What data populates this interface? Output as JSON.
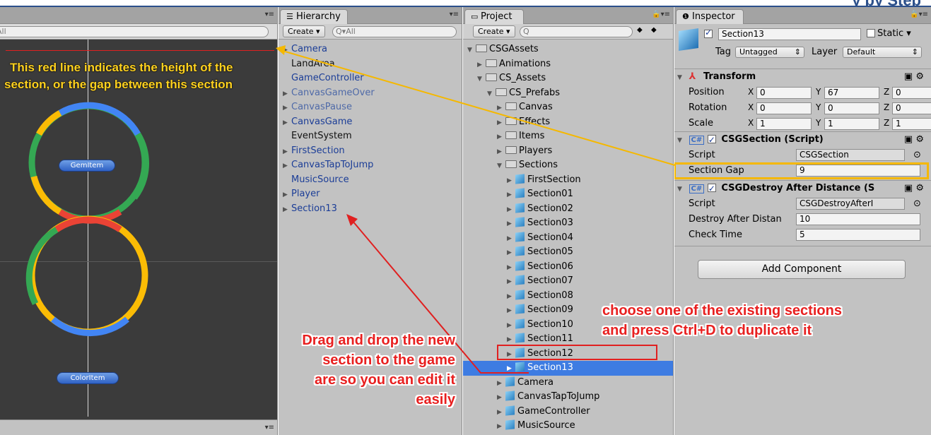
{
  "top": {
    "cutoff_text": "y by Step"
  },
  "scene": {
    "search_placeholder": "All",
    "items": [
      {
        "label": "GemItem"
      },
      {
        "label": "ColorItem"
      }
    ]
  },
  "hierarchy": {
    "tab": "Hierarchy",
    "create_label": "Create",
    "search_placeholder": "All",
    "items": [
      {
        "label": "Camera",
        "expandable": true
      },
      {
        "label": "LandArea",
        "expandable": false
      },
      {
        "label": "GameController",
        "expandable": false
      },
      {
        "label": "CanvasGameOver",
        "expandable": true
      },
      {
        "label": "CanvasPause",
        "expandable": true
      },
      {
        "label": "CanvasGame",
        "expandable": true
      },
      {
        "label": "EventSystem",
        "expandable": false
      },
      {
        "label": "FirstSection",
        "expandable": true
      },
      {
        "label": "CanvasTapToJump",
        "expandable": true
      },
      {
        "label": "MusicSource",
        "expandable": false
      },
      {
        "label": "Player",
        "expandable": true
      },
      {
        "label": "Section13",
        "expandable": true
      }
    ]
  },
  "project": {
    "tab": "Project",
    "create_label": "Create",
    "items": [
      {
        "label": "CSGAssets",
        "icon": "folder-icon",
        "indent": 0,
        "open": true
      },
      {
        "label": "Animations",
        "icon": "folder-icon",
        "indent": 1,
        "open": false
      },
      {
        "label": "CS_Assets",
        "icon": "folder-icon",
        "indent": 1,
        "open": true
      },
      {
        "label": "CS_Prefabs",
        "icon": "folder-icon",
        "indent": 2,
        "open": true
      },
      {
        "label": "Canvas",
        "icon": "folder-icon",
        "indent": 3,
        "open": false
      },
      {
        "label": "Effects",
        "icon": "folder-icon",
        "indent": 3,
        "open": false
      },
      {
        "label": "Items",
        "icon": "folder-icon",
        "indent": 3,
        "open": false
      },
      {
        "label": "Players",
        "icon": "folder-icon",
        "indent": 3,
        "open": false
      },
      {
        "label": "Sections",
        "icon": "folder-icon",
        "indent": 3,
        "open": true
      },
      {
        "label": "FirstSection",
        "icon": "prefab-icon",
        "indent": 4
      },
      {
        "label": "Section01",
        "icon": "prefab-icon",
        "indent": 4
      },
      {
        "label": "Section02",
        "icon": "prefab-icon",
        "indent": 4
      },
      {
        "label": "Section03",
        "icon": "prefab-icon",
        "indent": 4
      },
      {
        "label": "Section04",
        "icon": "prefab-icon",
        "indent": 4
      },
      {
        "label": "Section05",
        "icon": "prefab-icon",
        "indent": 4
      },
      {
        "label": "Section06",
        "icon": "prefab-icon",
        "indent": 4
      },
      {
        "label": "Section07",
        "icon": "prefab-icon",
        "indent": 4
      },
      {
        "label": "Section08",
        "icon": "prefab-icon",
        "indent": 4
      },
      {
        "label": "Section09",
        "icon": "prefab-icon",
        "indent": 4
      },
      {
        "label": "Section10",
        "icon": "prefab-icon",
        "indent": 4
      },
      {
        "label": "Section11",
        "icon": "prefab-icon",
        "indent": 4
      },
      {
        "label": "Section12",
        "icon": "prefab-icon",
        "indent": 4
      },
      {
        "label": "Section13",
        "icon": "prefab-icon",
        "indent": 4,
        "selected": true
      },
      {
        "label": "Camera",
        "icon": "prefab-icon",
        "indent": 3
      },
      {
        "label": "CanvasTapToJump",
        "icon": "prefab-icon",
        "indent": 3
      },
      {
        "label": "GameController",
        "icon": "prefab-icon",
        "indent": 3
      },
      {
        "label": "MusicSource",
        "icon": "prefab-icon",
        "indent": 3
      }
    ]
  },
  "inspector": {
    "tab": "Inspector",
    "object_name": "Section13",
    "static_label": "Static",
    "tag_label": "Tag",
    "tag_value": "Untagged",
    "layer_label": "Layer",
    "layer_value": "Default",
    "transform": {
      "title": "Transform",
      "position_label": "Position",
      "rotation_label": "Rotation",
      "scale_label": "Scale",
      "x": "X",
      "y": "Y",
      "z": "Z",
      "position": [
        "0",
        "67",
        "0"
      ],
      "rotation": [
        "0",
        "0",
        "0"
      ],
      "scale": [
        "1",
        "1",
        "1"
      ]
    },
    "section_script": {
      "title": "CSGSection (Script)",
      "script_label": "Script",
      "script_value": "CSGSection",
      "gap_label": "Section Gap",
      "gap_value": "9"
    },
    "destroy_script": {
      "title": "CSGDestroy After Distance (S",
      "script_label": "Script",
      "script_value": "CSGDestroyAfterI",
      "distance_label": "Destroy After Distan",
      "distance_value": "10",
      "check_label": "Check Time",
      "check_value": "5"
    },
    "add_component": "Add Component"
  },
  "annotations": {
    "red_line_note_1": "This red line indicates the height of the",
    "red_line_note_2": "section, or the gap between this section",
    "duplicate_note_1": "choose one of the existing sections",
    "duplicate_note_2": "and press Ctrl+D to duplicate it",
    "drag_note_1": "Drag and drop the new",
    "drag_note_2": "section to the game",
    "drag_note_3": "are so you can edit it",
    "drag_note_4": "easily"
  },
  "colors": {
    "ring_blue": "#4285f4",
    "ring_red": "#ea4335",
    "ring_yellow": "#fbbc05",
    "ring_green": "#34a853",
    "annotation_yellow": "#ffd21f",
    "annotation_red": "#e82020"
  }
}
